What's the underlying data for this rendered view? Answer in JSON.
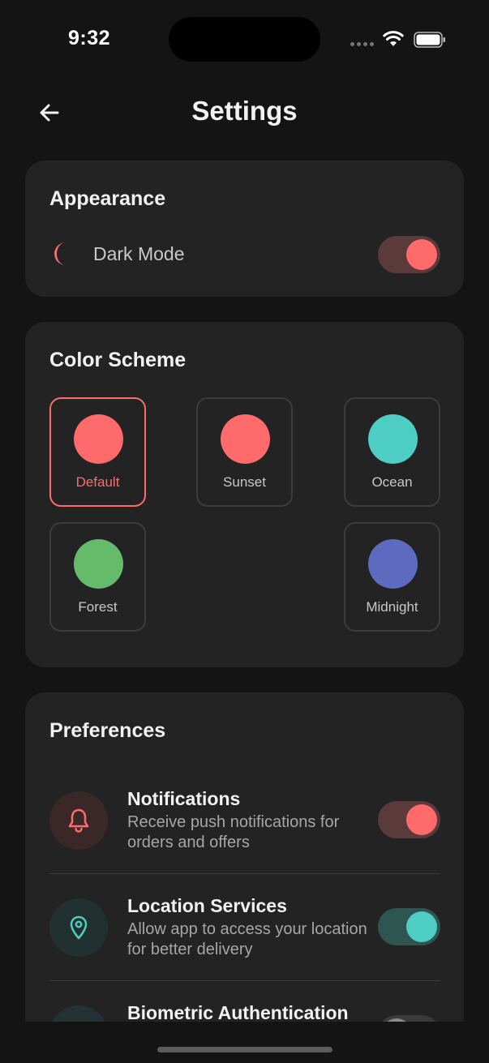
{
  "status_bar": {
    "time": "9:32"
  },
  "header": {
    "title": "Settings",
    "back_icon": "arrow-left-icon"
  },
  "appearance": {
    "title": "Appearance",
    "dark_mode": {
      "label": "Dark Mode",
      "icon": "moon-icon",
      "enabled": true
    }
  },
  "color_scheme": {
    "title": "Color Scheme",
    "options": [
      {
        "name": "Default",
        "color": "#ff6b6b",
        "selected": true
      },
      {
        "name": "Sunset",
        "color": "#ff6b6b",
        "selected": false
      },
      {
        "name": "Ocean",
        "color": "#4ecdc4",
        "selected": false
      },
      {
        "name": "Forest",
        "color": "#66bb6a",
        "selected": false
      },
      {
        "name": "Midnight",
        "color": "#5c6bc0",
        "selected": false
      }
    ]
  },
  "preferences": {
    "title": "Preferences",
    "items": [
      {
        "title": "Notifications",
        "description": "Receive push notifications for orders and offers",
        "icon": "bell-icon",
        "enabled": true
      },
      {
        "title": "Location Services",
        "description": "Allow app to access your location for better delivery",
        "icon": "map-pin-icon",
        "enabled": true
      },
      {
        "title": "Biometric Authentication",
        "description": "",
        "icon": "fingerprint-icon",
        "enabled": false
      }
    ]
  },
  "colors": {
    "accent": "#ff6b6b",
    "teal": "#4ecdc4",
    "background": "#141414",
    "card": "#232323"
  }
}
